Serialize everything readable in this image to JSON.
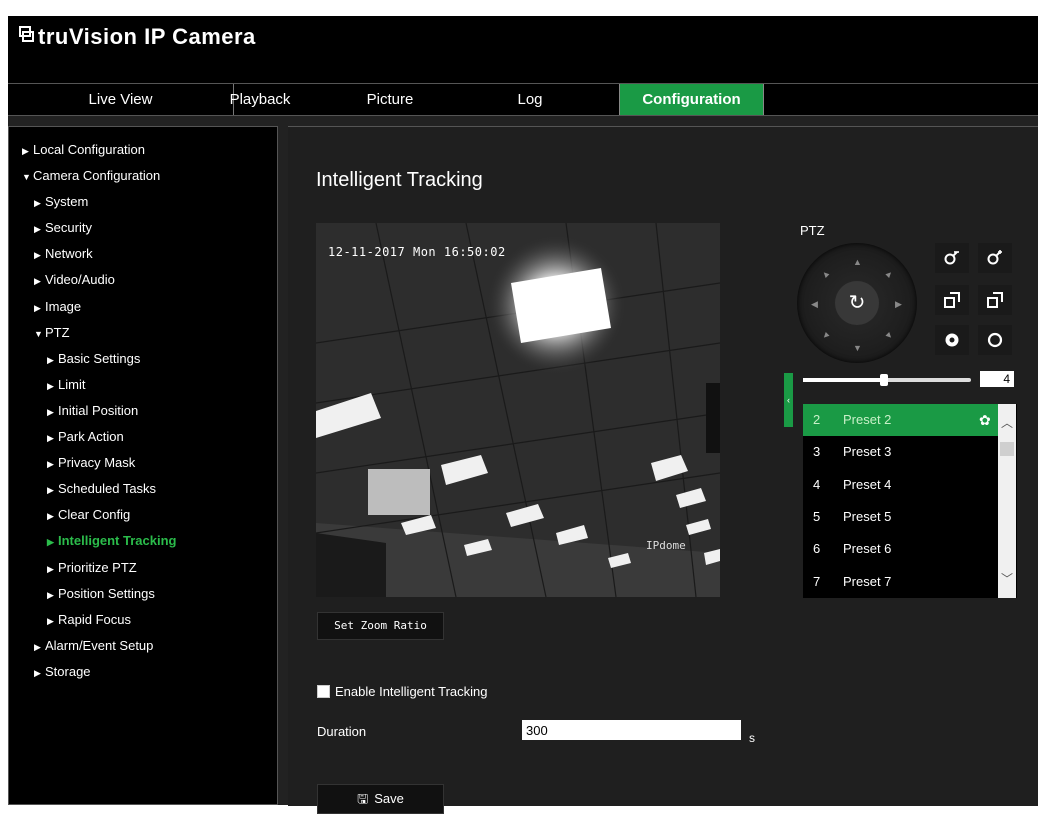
{
  "header": {
    "brand_prefix": "truVision",
    "brand_suffix": "IP Camera"
  },
  "nav": {
    "tabs": [
      "Live View",
      "Playback",
      "Picture",
      "Log",
      "Configuration"
    ],
    "active": "Configuration"
  },
  "sidebar": {
    "items": [
      {
        "label": "Local Configuration",
        "arrow": "▶"
      },
      {
        "label": "Camera Configuration",
        "arrow": "▼"
      },
      {
        "label": "System",
        "arrow": "▶"
      },
      {
        "label": "Security",
        "arrow": "▶"
      },
      {
        "label": "Network",
        "arrow": "▶"
      },
      {
        "label": "Video/Audio",
        "arrow": "▶"
      },
      {
        "label": "Image",
        "arrow": "▶"
      },
      {
        "label": "PTZ",
        "arrow": "▼"
      },
      {
        "label": "Basic Settings",
        "arrow": "▶"
      },
      {
        "label": "Limit",
        "arrow": "▶"
      },
      {
        "label": "Initial Position",
        "arrow": "▶"
      },
      {
        "label": "Park Action",
        "arrow": "▶"
      },
      {
        "label": "Privacy Mask",
        "arrow": "▶"
      },
      {
        "label": "Scheduled Tasks",
        "arrow": "▶"
      },
      {
        "label": "Clear Config",
        "arrow": "▶"
      },
      {
        "label": "Intelligent Tracking",
        "arrow": "▶"
      },
      {
        "label": "Prioritize PTZ",
        "arrow": "▶"
      },
      {
        "label": "Position Settings",
        "arrow": "▶"
      },
      {
        "label": "Rapid Focus",
        "arrow": "▶"
      },
      {
        "label": "Alarm/Event Setup",
        "arrow": "▶"
      },
      {
        "label": "Storage",
        "arrow": "▶"
      }
    ],
    "active": "Intelligent Tracking"
  },
  "page": {
    "title": "Intelligent Tracking"
  },
  "video": {
    "timestamp": "12-11-2017 Mon 16:50:02",
    "osd_name": "IPdome"
  },
  "ptz": {
    "label": "PTZ",
    "speed": "4",
    "speed_fraction": 0.48,
    "center_icon": "↻",
    "buttons": [
      {
        "name": "zoom-out-icon",
        "glyph": "🔍−"
      },
      {
        "name": "zoom-in-icon",
        "glyph": "🔍+"
      },
      {
        "name": "focus-near-icon",
        "glyph": "⧉"
      },
      {
        "name": "focus-far-icon",
        "glyph": "⧉"
      },
      {
        "name": "iris-close-icon",
        "glyph": "●"
      },
      {
        "name": "iris-open-icon",
        "glyph": "○"
      }
    ],
    "collapse_icon": "‹"
  },
  "presets": [
    {
      "num": "2",
      "name": "Preset 2"
    },
    {
      "num": "3",
      "name": "Preset 3"
    },
    {
      "num": "4",
      "name": "Preset 4"
    },
    {
      "num": "5",
      "name": "Preset 5"
    },
    {
      "num": "6",
      "name": "Preset 6"
    },
    {
      "num": "7",
      "name": "Preset 7"
    }
  ],
  "active_preset": "Preset 2",
  "form": {
    "zoom_button": "Set Zoom Ratio",
    "enable_label": "Enable Intelligent Tracking",
    "enable_checked": false,
    "duration_label": "Duration",
    "duration_value": "300",
    "duration_unit": "s",
    "save_label": "Save"
  },
  "colors": {
    "accent": "#1a9a45",
    "active_text": "#2bbc4b"
  }
}
